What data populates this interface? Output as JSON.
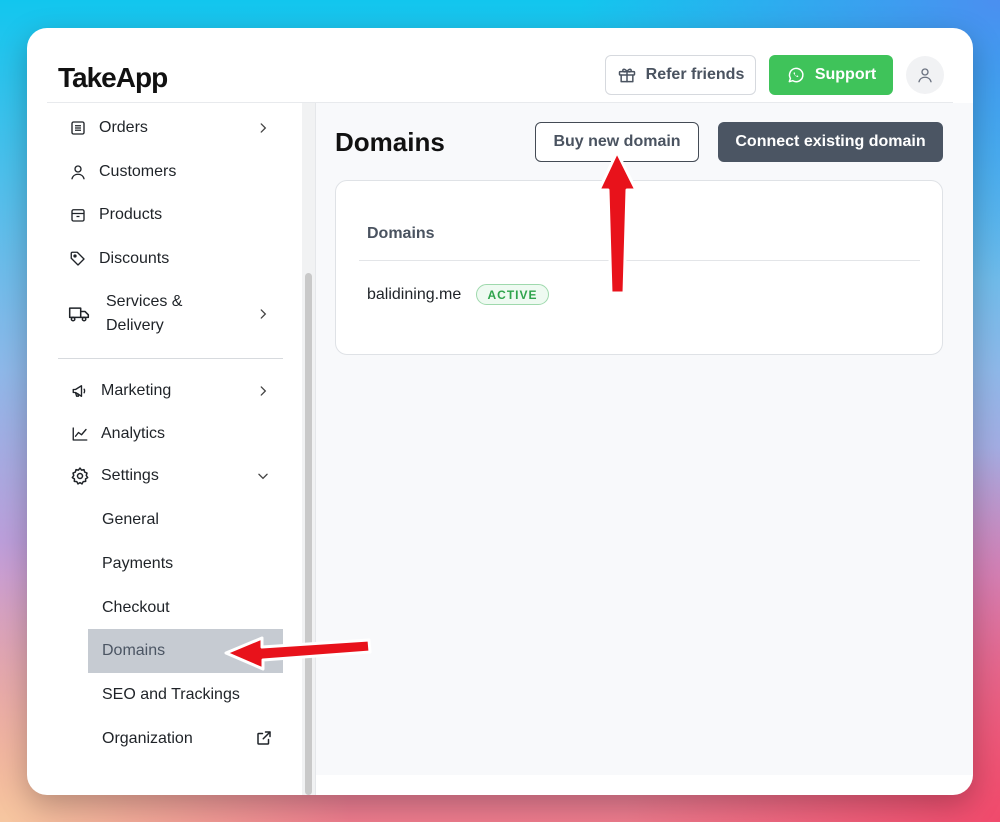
{
  "app": {
    "logo": "TakeApp"
  },
  "header": {
    "refer_label": "Refer friends",
    "support_label": "Support"
  },
  "sidebar": {
    "items": [
      {
        "label": "Orders",
        "icon": "orders-list-icon",
        "has_chevron": "right"
      },
      {
        "label": "Customers",
        "icon": "user-icon"
      },
      {
        "label": "Products",
        "icon": "box-icon"
      },
      {
        "label": "Discounts",
        "icon": "tag-icon"
      },
      {
        "label_line1": "Services &",
        "label_line2": "Delivery",
        "icon": "truck-icon",
        "has_chevron": "right"
      },
      {
        "label": "Marketing",
        "icon": "megaphone-icon",
        "has_chevron": "right"
      },
      {
        "label": "Analytics",
        "icon": "line-chart-icon"
      },
      {
        "label": "Settings",
        "icon": "gear-icon",
        "has_chevron": "down"
      }
    ],
    "settings_sub": [
      {
        "label": "General"
      },
      {
        "label": "Payments"
      },
      {
        "label": "Checkout"
      },
      {
        "label": "Domains",
        "active": true
      },
      {
        "label": "SEO and Trackings"
      },
      {
        "label": "Organization",
        "icon": "external-link-icon"
      }
    ]
  },
  "main": {
    "title": "Domains",
    "buy_label": "Buy new domain",
    "connect_label": "Connect existing domain",
    "table": {
      "column_header": "Domains",
      "rows": [
        {
          "domain": "balidining.me",
          "status": "ACTIVE"
        }
      ]
    }
  },
  "colors": {
    "support_green": "#3fc35a",
    "connect_dark": "#4b5563",
    "active_badge": "#2fa44c",
    "annotation_red": "#e8121b",
    "active_nav_bg": "#c6cbd2"
  }
}
